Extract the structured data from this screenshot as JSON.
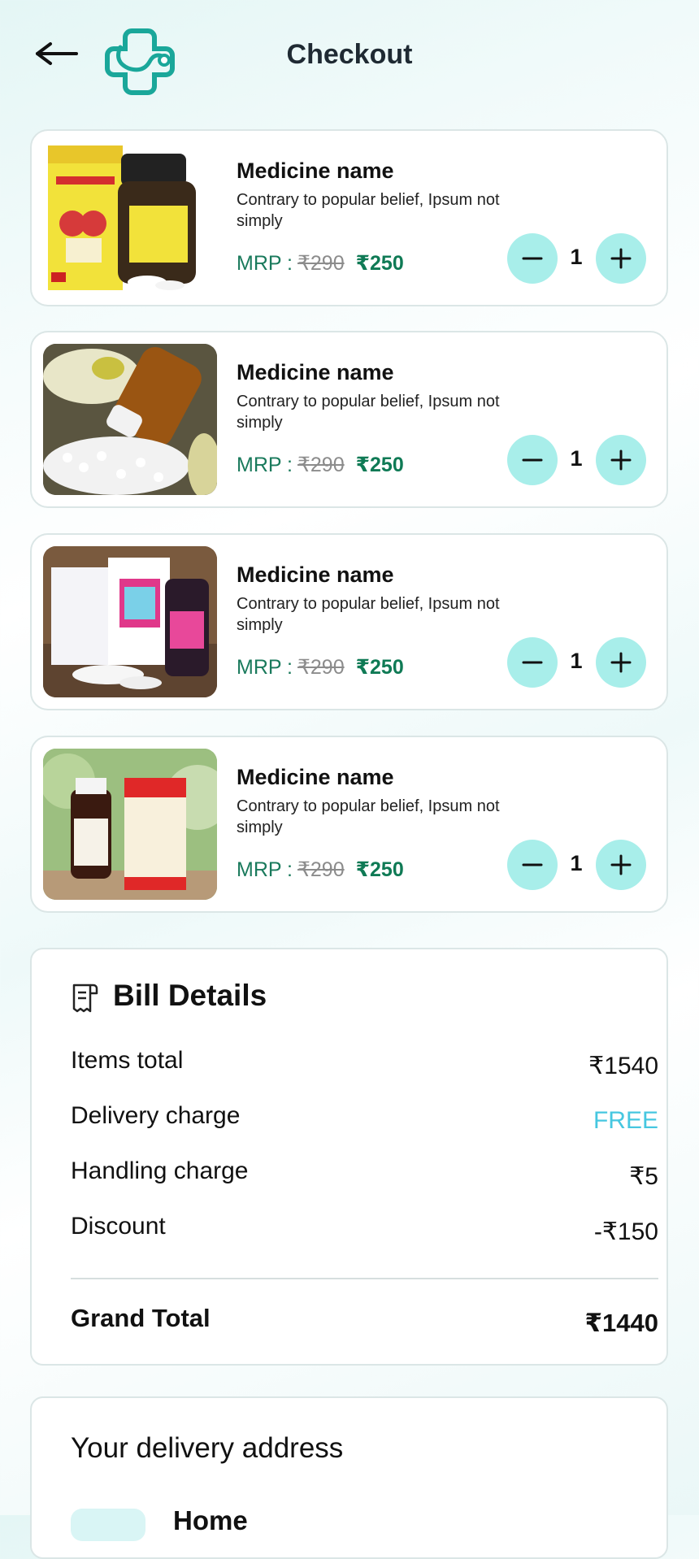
{
  "header": {
    "title": "Checkout",
    "back_icon": "arrow-left-icon",
    "logo_icon": "medical-cross-stethoscope-icon",
    "brand_color": "#1aa79a"
  },
  "cart": {
    "items": [
      {
        "name": "Medicine name",
        "description": "Contrary to popular belief, Ipsum not simply",
        "mrp_label": "MRP :",
        "old_price": "₹290",
        "price": "₹250",
        "quantity": "1"
      },
      {
        "name": "Medicine name",
        "description": "Contrary to popular belief, Ipsum not simply",
        "mrp_label": "MRP :",
        "old_price": "₹290",
        "price": "₹250",
        "quantity": "1"
      },
      {
        "name": "Medicine name",
        "description": "Contrary to popular belief, Ipsum not simply",
        "mrp_label": "MRP :",
        "old_price": "₹290",
        "price": "₹250",
        "quantity": "1"
      },
      {
        "name": "Medicine name",
        "description": "Contrary to popular belief, Ipsum not simply",
        "mrp_label": "MRP :",
        "old_price": "₹290",
        "price": "₹250",
        "quantity": "1"
      }
    ],
    "minus_icon": "minus-icon",
    "plus_icon": "plus-icon",
    "button_color": "#a8eeea"
  },
  "bill": {
    "title": "Bill Details",
    "icon": "receipt-icon",
    "rows": [
      {
        "label": "Items total",
        "value": "₹1540"
      },
      {
        "label": "Delivery charge",
        "value": "FREE"
      },
      {
        "label": "Handling charge",
        "value": "₹5"
      },
      {
        "label": "Discount",
        "value": "-₹150"
      }
    ],
    "grand_total_label": "Grand Total",
    "grand_total_value": "₹1440",
    "free_color": "#46c7e0"
  },
  "address": {
    "title": "Your delivery address",
    "label": "Home"
  }
}
